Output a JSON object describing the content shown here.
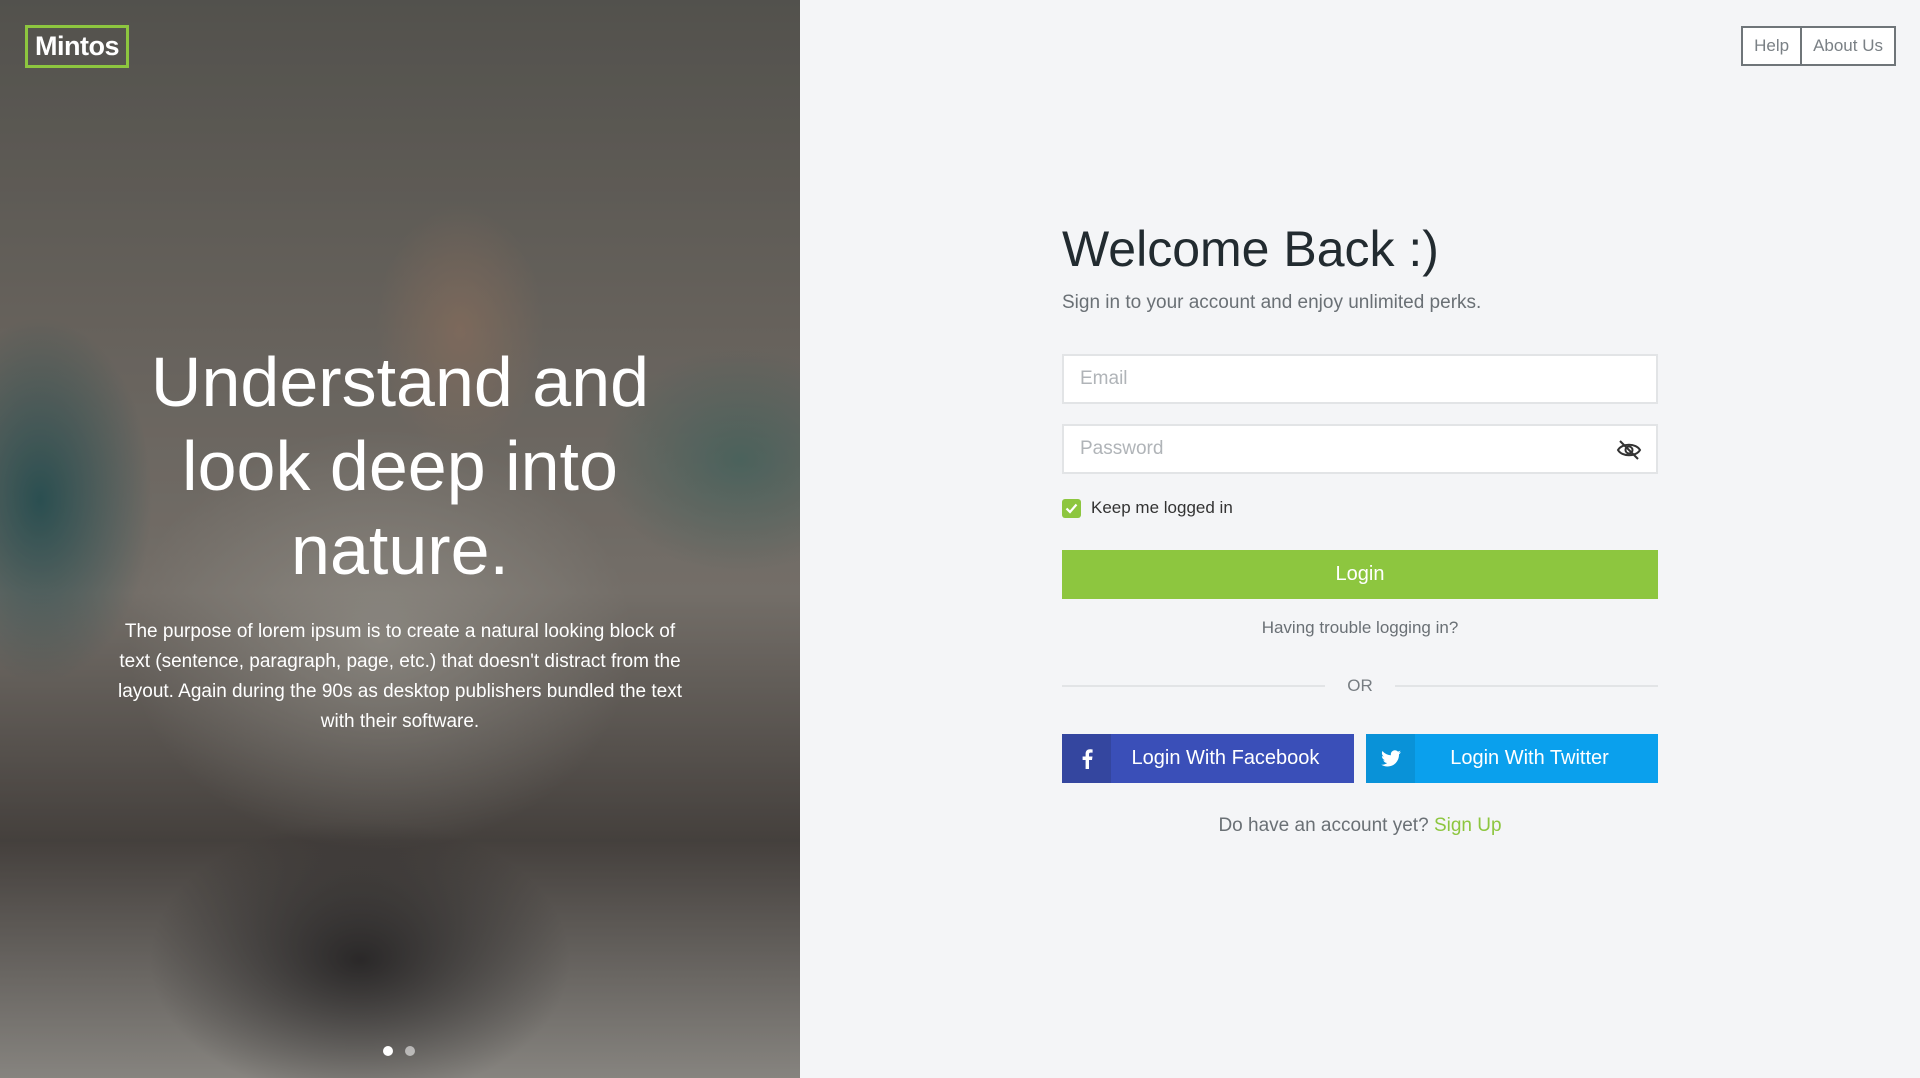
{
  "brand": {
    "logo_text": "Mintos",
    "accent_color": "#8dc63f"
  },
  "hero": {
    "title": "Understand and look deep into nature.",
    "text": "The purpose of lorem ipsum is to create a natural looking block of text (sentence, paragraph, page, etc.) that doesn't distract from the layout. Again during the 90s as desktop publishers bundled the text with their software.",
    "slides": {
      "count": 2,
      "active": 1
    }
  },
  "nav": {
    "help_label": "Help",
    "about_label": "About Us"
  },
  "form": {
    "title": "Welcome Back :)",
    "subtitle": "Sign in to your account and enjoy unlimited perks.",
    "email": {
      "placeholder": "Email",
      "value": ""
    },
    "password": {
      "placeholder": "Password",
      "value": ""
    },
    "remember": {
      "label": "Keep me logged in",
      "checked": true
    },
    "login_label": "Login",
    "trouble_label": "Having trouble logging in?",
    "divider_label": "OR",
    "facebook_label": "Login With Facebook",
    "twitter_label": "Login With Twitter",
    "signup_prompt": "Do have an account yet?",
    "signup_link": "Sign Up"
  },
  "icons": {
    "password_toggle": "eye-slash-icon",
    "remember_check": "check-icon",
    "facebook": "facebook-icon",
    "twitter": "twitter-icon"
  },
  "colors": {
    "facebook": "#3a4fb8",
    "twitter": "#0aa0ed",
    "login": "#8dc63f"
  }
}
